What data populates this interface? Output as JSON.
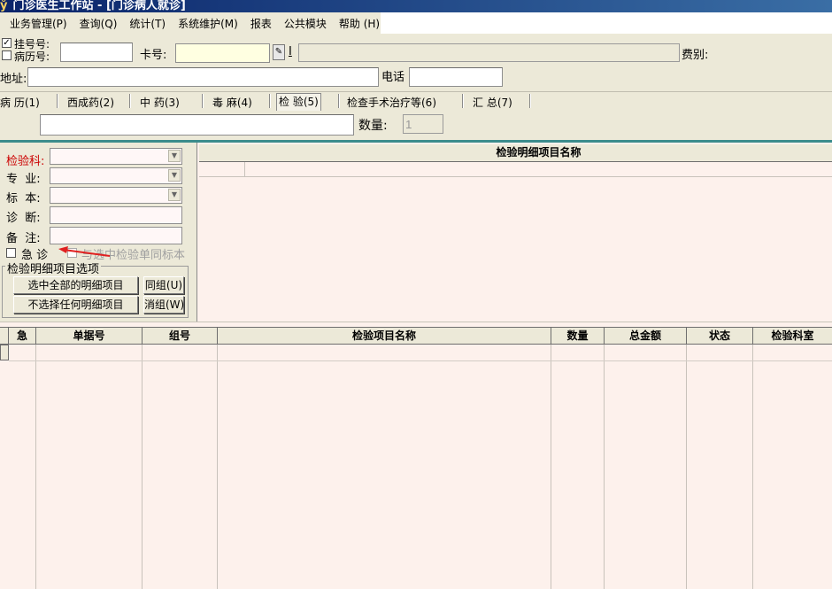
{
  "window": {
    "title": "门诊医生工作站 - [门诊病人就诊]"
  },
  "menu": [
    {
      "label": "业务管理(P)"
    },
    {
      "label": "查询(Q)"
    },
    {
      "label": "统计(T)"
    },
    {
      "label": "系统维护(M)"
    },
    {
      "label": "报表"
    },
    {
      "label": "公共模块"
    },
    {
      "label": "帮助 (H)"
    }
  ],
  "header_form": {
    "reg_no_label": "挂号号:",
    "reg_no_checked": true,
    "record_no_label": "病历号:",
    "record_no_checked": false,
    "card_label": "卡号:",
    "card_tail": "I",
    "fee_label": "费别:",
    "address_label": "地址:",
    "phone_label": "电话"
  },
  "tabs": [
    {
      "label": "病 历(1)"
    },
    {
      "label": "西成药(2)"
    },
    {
      "label": "中 药(3)"
    },
    {
      "label": "毒 麻(4)"
    },
    {
      "label": "检 验(5)",
      "active": true
    },
    {
      "label": "检查手术治疗等(6)"
    },
    {
      "label": "汇 总(7)"
    }
  ],
  "quantity": {
    "label": "数量:",
    "value": "1"
  },
  "lab_form": {
    "dept_label": "检验科:",
    "specialty_label": "专  业:",
    "specimen_label": "标  本:",
    "diagnosis_label": "诊  断:",
    "remark_label": "备  注:",
    "urgent_label": "急 诊",
    "same_specimen_label": "与选中检验单同标本",
    "group_title": "检验明细项目选项",
    "select_all_button": "选中全部的明细项目",
    "select_none_button": "不选择任何明细项目",
    "group_button": "同组(U)",
    "ungroup_button": "消组(W)"
  },
  "detail_grid": {
    "header": "检验明细项目名称"
  },
  "order_grid": {
    "columns": [
      "急",
      "单据号",
      "组号",
      "检验项目名称",
      "数量",
      "总金额",
      "状态",
      "检验科室"
    ]
  },
  "colors": {
    "title_bar": "#0a246a",
    "dept_label_red": "#cc0000",
    "grid_bg": "#fdf1ec",
    "arrow": "#e02020",
    "divider_teal": "#3b8c8c"
  }
}
